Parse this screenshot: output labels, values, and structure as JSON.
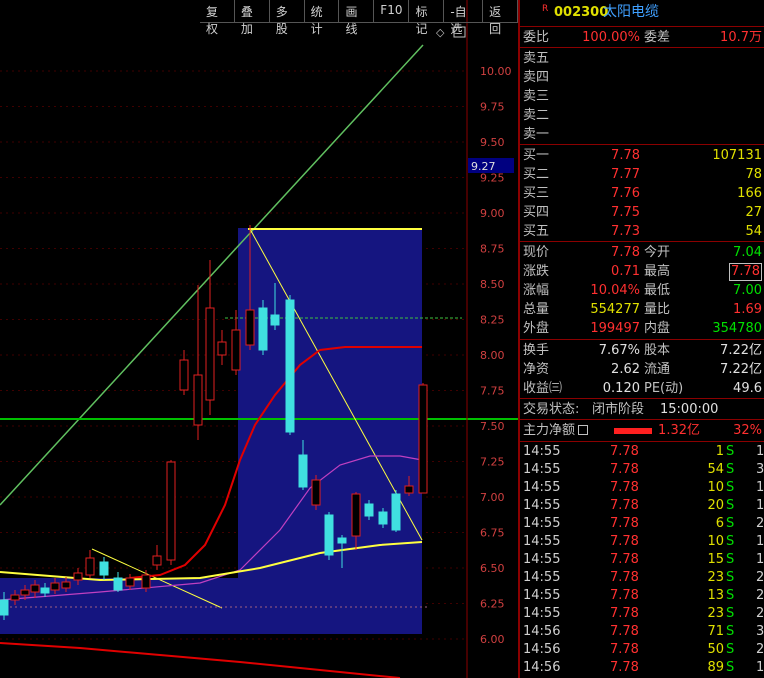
{
  "toolbar": [
    "复权",
    "叠加",
    "多股",
    "统计",
    "画线",
    "F10",
    "标记",
    "-自选",
    "返回"
  ],
  "stock": {
    "badge": "R",
    "code": "002300",
    "name": "太阳电缆"
  },
  "current_price_tag": "9.27",
  "axis_ticks": [
    "10.00",
    "9.75",
    "9.50",
    "9.25",
    "9.00",
    "8.75",
    "8.50",
    "8.25",
    "8.00",
    "7.75",
    "7.50",
    "7.25",
    "7.00",
    "6.75",
    "6.50",
    "6.25",
    "6.00"
  ],
  "weibi": {
    "label1": "委比",
    "value1": "100.00%",
    "label2": "委差",
    "value2": "10.7万"
  },
  "sells": [
    {
      "label": "卖五"
    },
    {
      "label": "卖四"
    },
    {
      "label": "卖三"
    },
    {
      "label": "卖二"
    },
    {
      "label": "卖一"
    }
  ],
  "buys": [
    {
      "label": "买一",
      "price": "7.78",
      "vol": "107131"
    },
    {
      "label": "买二",
      "price": "7.77",
      "vol": "78"
    },
    {
      "label": "买三",
      "price": "7.76",
      "vol": "166"
    },
    {
      "label": "买四",
      "price": "7.75",
      "vol": "27"
    },
    {
      "label": "买五",
      "price": "7.73",
      "vol": "54"
    }
  ],
  "stats1": [
    {
      "l1": "现价",
      "v1": "7.78",
      "l2": "今开",
      "v2": "7.04",
      "c1": "red",
      "c2": "green"
    },
    {
      "l1": "涨跌",
      "v1": "0.71",
      "l2": "最高",
      "v2": "7.78",
      "c1": "red",
      "c2": "red"
    },
    {
      "l1": "涨幅",
      "v1": "10.04%",
      "l2": "最低",
      "v2": "7.00",
      "c1": "red",
      "c2": "green"
    },
    {
      "l1": "总量",
      "v1": "554277",
      "l2": "量比",
      "v2": "1.69",
      "c1": "yellow",
      "c2": "red"
    },
    {
      "l1": "外盘",
      "v1": "199497",
      "l2": "内盘",
      "v2": "354780",
      "c1": "red",
      "c2": "green"
    }
  ],
  "stats2": [
    {
      "l1": "换手",
      "v1": "7.67%",
      "l2": "股本",
      "v2": "7.22亿"
    },
    {
      "l1": "净资",
      "v1": "2.62",
      "l2": "流通",
      "v2": "7.22亿"
    },
    {
      "l1": "收益㈢",
      "v1": "0.120",
      "l2": "PE(动)",
      "v2": "49.6"
    }
  ],
  "trade_status": {
    "label": "交易状态:",
    "value": "闭市阶段",
    "time": "15:00:00"
  },
  "main_flow": {
    "label": "主力净额",
    "value": "1.32亿",
    "pct": "32%"
  },
  "ticks": [
    {
      "t": "14:55",
      "p": "7.78",
      "v": "1",
      "s": "S",
      "n": "1"
    },
    {
      "t": "14:55",
      "p": "7.78",
      "v": "54",
      "s": "S",
      "n": "3"
    },
    {
      "t": "14:55",
      "p": "7.78",
      "v": "10",
      "s": "S",
      "n": "1"
    },
    {
      "t": "14:55",
      "p": "7.78",
      "v": "20",
      "s": "S",
      "n": "1"
    },
    {
      "t": "14:55",
      "p": "7.78",
      "v": "6",
      "s": "S",
      "n": "2"
    },
    {
      "t": "14:55",
      "p": "7.78",
      "v": "10",
      "s": "S",
      "n": "1"
    },
    {
      "t": "14:55",
      "p": "7.78",
      "v": "15",
      "s": "S",
      "n": "1"
    },
    {
      "t": "14:55",
      "p": "7.78",
      "v": "23",
      "s": "S",
      "n": "2"
    },
    {
      "t": "14:55",
      "p": "7.78",
      "v": "13",
      "s": "S",
      "n": "2"
    },
    {
      "t": "14:55",
      "p": "7.78",
      "v": "23",
      "s": "S",
      "n": "2"
    },
    {
      "t": "14:56",
      "p": "7.78",
      "v": "71",
      "s": "S",
      "n": "3"
    },
    {
      "t": "14:56",
      "p": "7.78",
      "v": "50",
      "s": "S",
      "n": "2"
    },
    {
      "t": "14:56",
      "p": "7.78",
      "v": "89",
      "s": "S",
      "n": "1"
    }
  ],
  "colors": {
    "up": "#ff3030",
    "down": "#00e000",
    "price": "#e0e000",
    "bg": "#000000",
    "ma_red": "#e00000",
    "ma_yellow": "#ffff40",
    "ma_purple": "#c040c0"
  }
}
